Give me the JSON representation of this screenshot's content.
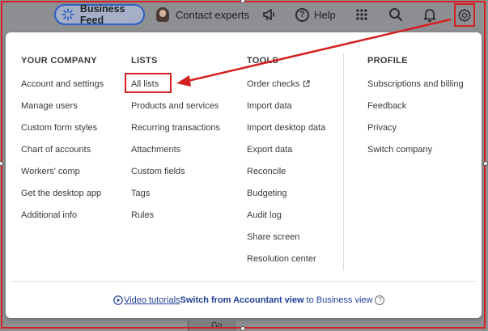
{
  "topbar": {
    "business_feed": "Business Feed",
    "contact_experts": "Contact experts",
    "help": "Help",
    "icons": [
      "megaphone-icon",
      "help-icon",
      "apps-grid-icon",
      "search-icon",
      "bell-icon",
      "gear-icon"
    ]
  },
  "menu": {
    "columns": [
      {
        "heading": "YOUR COMPANY",
        "items": [
          "Account and settings",
          "Manage users",
          "Custom form styles",
          "Chart of accounts",
          "Workers' comp",
          "Get the desktop app",
          "Additional info"
        ]
      },
      {
        "heading": "LISTS",
        "items": [
          "All lists",
          "Products and services",
          "Recurring transactions",
          "Attachments",
          "Custom fields",
          "Tags",
          "Rules"
        ]
      },
      {
        "heading": "TOOLS",
        "items": [
          "Order checks",
          "Import data",
          "Import desktop data",
          "Export data",
          "Reconcile",
          "Budgeting",
          "Audit log",
          "Share screen",
          "Resolution center"
        ]
      },
      {
        "heading": "PROFILE",
        "items": [
          "Subscriptions and billing",
          "Feedback",
          "Privacy",
          "Switch company"
        ]
      }
    ],
    "footer": {
      "video_tutorials": "Video tutorials",
      "switch_label": "Switch from Accountant view",
      "switch_target": "to Business view",
      "help_glyph": "?"
    }
  },
  "peek_text": "Go",
  "colors": {
    "annotation_red": "#d42020",
    "accent_blue": "#2f5ec4",
    "link_blue": "#1f3f97"
  }
}
